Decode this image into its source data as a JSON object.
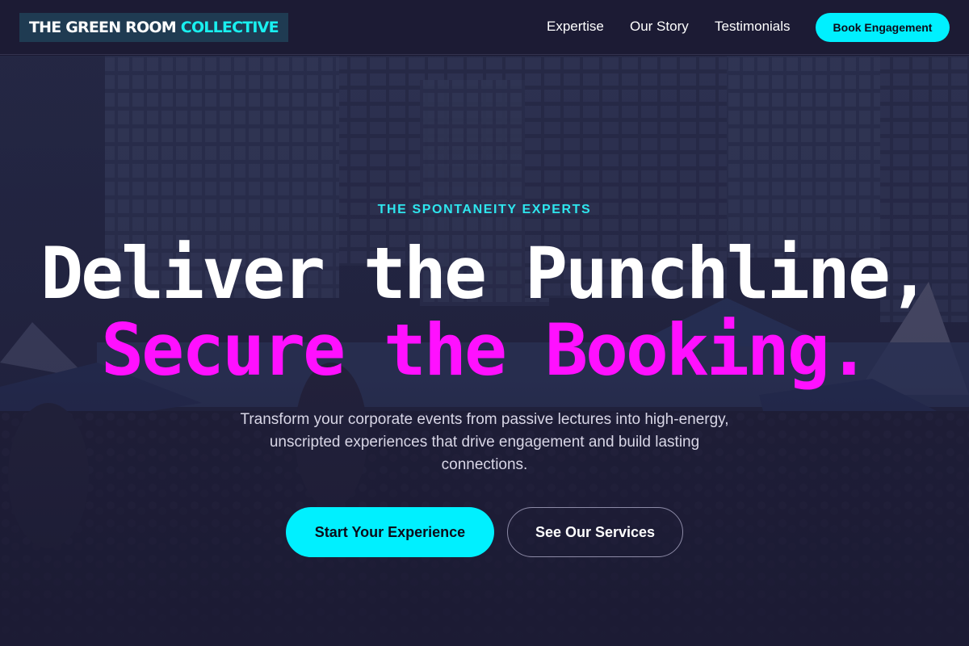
{
  "brand": {
    "name_part1": "THE GREEN ROOM",
    "name_part2": "COLLECTIVE"
  },
  "nav": {
    "links": [
      "Expertise",
      "Our Story",
      "Testimonials"
    ],
    "cta_label": "Book Engagement"
  },
  "hero": {
    "background_image": "crowd-and-tents-cityscape-photo",
    "eyebrow": "THE SPONTANEITY EXPERTS",
    "headline_line1": "Deliver the Punchline,",
    "headline_line2": "Secure the Booking.",
    "description": "Transform your corporate events from passive lectures into high-energy, unscripted experiences that drive engagement and build lasting connections.",
    "primary_button": "Start Your Experience",
    "secondary_button": "See Our Services"
  },
  "colors": {
    "page_background": "#1b1a33",
    "accent_cyan": "#00f0ff",
    "accent_magenta": "#ff10ff",
    "logo_background": "#1f3b52"
  }
}
